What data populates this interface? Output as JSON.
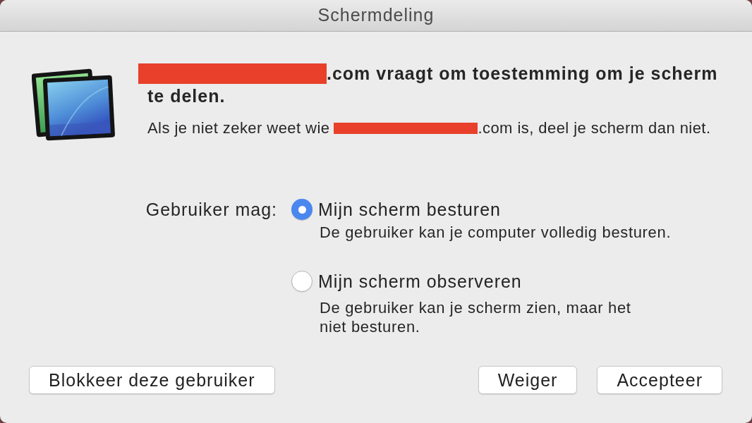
{
  "window": {
    "title": "Schermdeling"
  },
  "message": {
    "heading_lines": [
      [
        {
          "kind": "redacted"
        },
        {
          "kind": "text",
          "text": ".com vraagt om toestemming om je scherm"
        }
      ],
      [
        {
          "kind": "text",
          "text": "te delen."
        }
      ]
    ],
    "detail": [
      {
        "kind": "text",
        "text": "Als je niet zeker weet wie"
      },
      {
        "kind": "redacted"
      },
      {
        "kind": "text",
        "text": ".com is, deel je scherm dan niet."
      }
    ]
  },
  "permission": {
    "label": "Gebruiker mag:",
    "options": [
      {
        "label": "Mijn scherm besturen",
        "description": "De gebruiker kan je computer volledig besturen.",
        "selected": true
      },
      {
        "label": "Mijn scherm observeren",
        "description": "De gebruiker kan je scherm zien, maar het niet besturen.",
        "selected": false
      }
    ]
  },
  "footer": {
    "left": [
      {
        "label": "Blokkeer deze gebruiker"
      }
    ],
    "right": [
      {
        "label": "Weiger"
      },
      {
        "label": "Accepteer"
      }
    ]
  }
}
